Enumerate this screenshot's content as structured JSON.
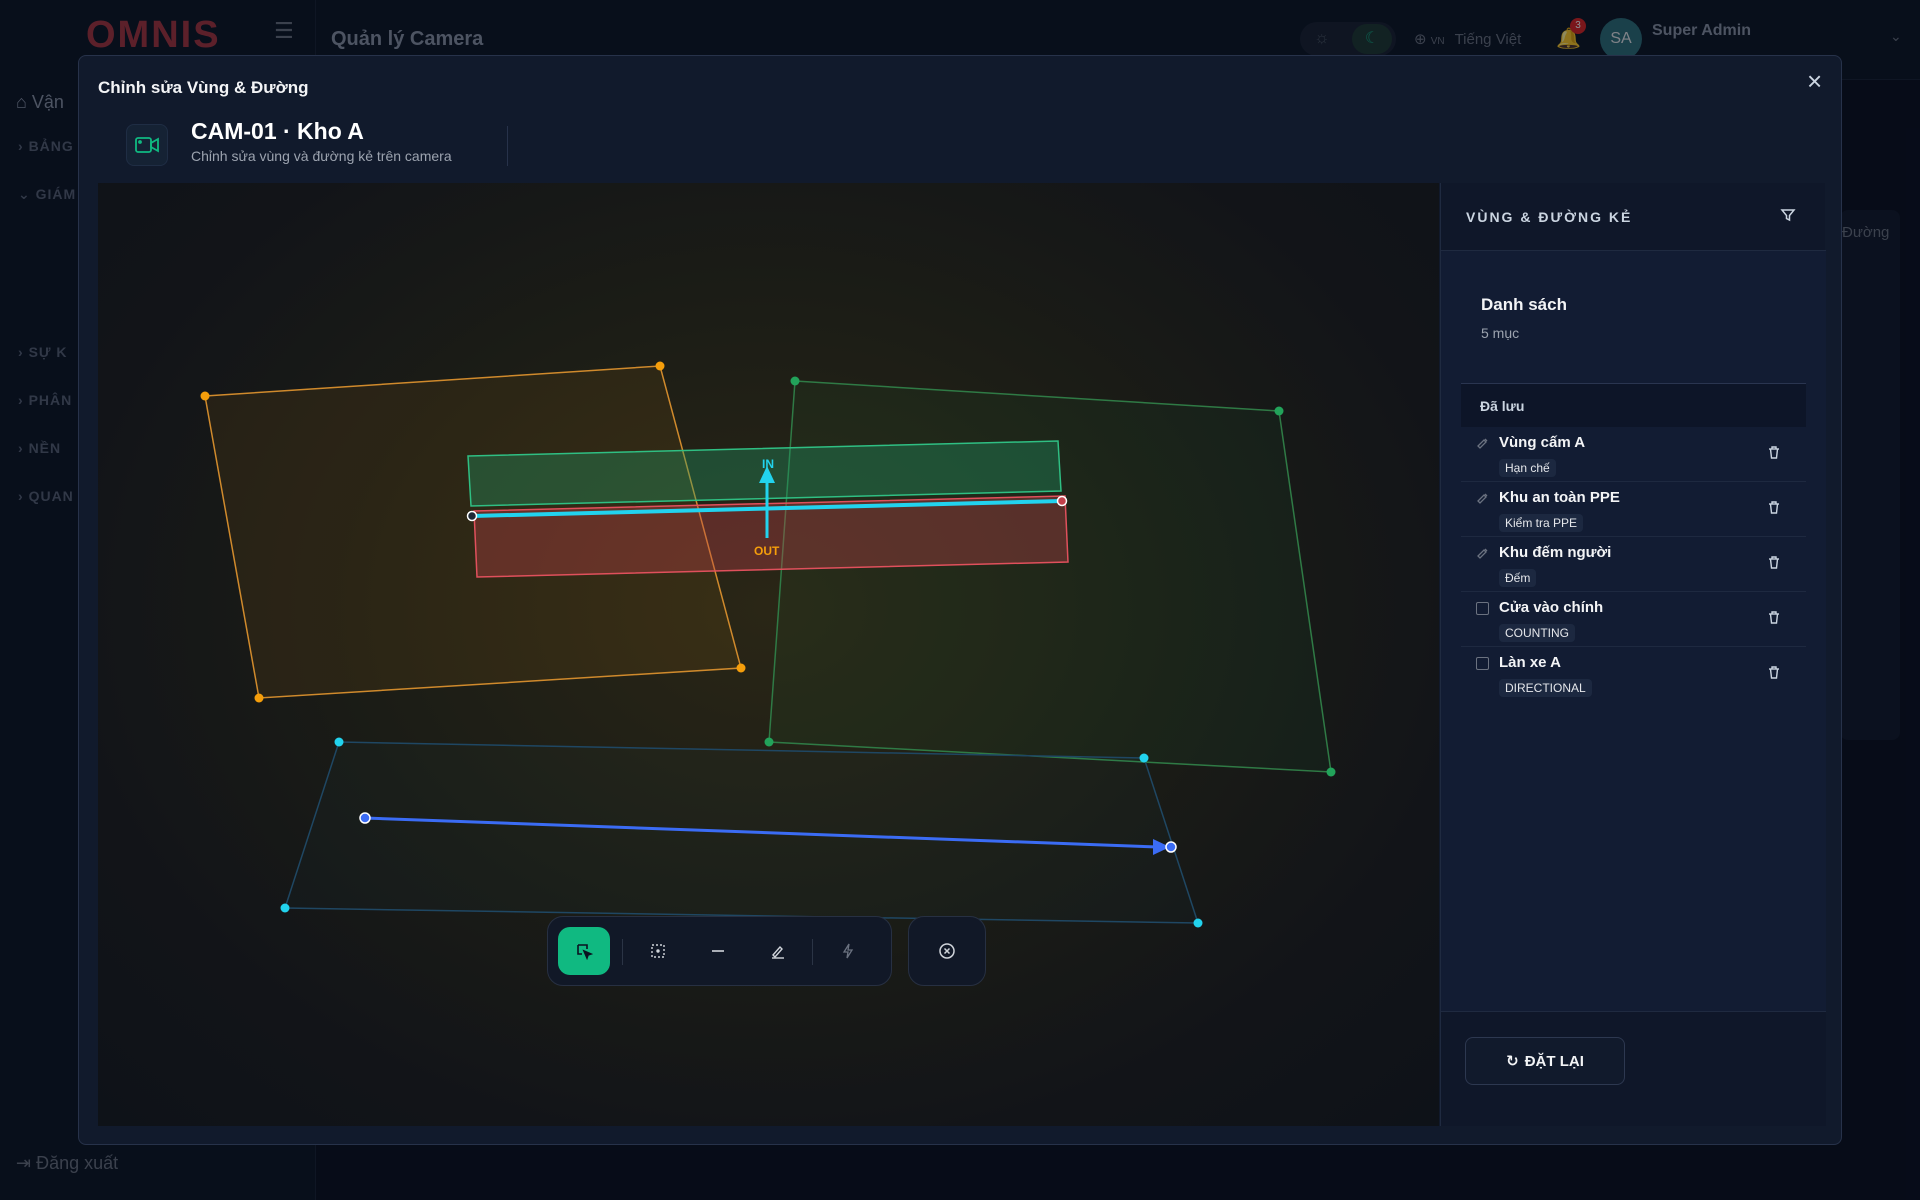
{
  "background": {
    "logo": "OMNIS",
    "page_title": "Quản lý Camera",
    "nav": {
      "home": "Vận",
      "sections": [
        "BẢNG",
        "GIÁM",
        "SỰ K",
        "PHÂN",
        "NỀN",
        "QUAN"
      ]
    },
    "logout": "Đăng xuất",
    "language": {
      "code": "VN",
      "label": "Tiếng Việt"
    },
    "notifications": "3",
    "user": {
      "initials": "SA",
      "name": "Super Admin"
    },
    "side_tab": "Đường"
  },
  "modal": {
    "title": "Chỉnh sửa Vùng & Đường",
    "camera": {
      "name": "CAM-01 · Kho A",
      "subtitle": "Chỉnh sửa vùng và đường kẻ trên camera"
    },
    "canvas": {
      "in_label": "IN",
      "out_label": "OUT"
    },
    "toolbar": {
      "tools": [
        "select-icon",
        "zone-icon",
        "line-icon",
        "draw-icon",
        "flash-icon"
      ],
      "active_tool": "select-icon",
      "cancel": "cancel-icon"
    },
    "panel": {
      "title": "VÙNG & ĐƯỜNG KẺ",
      "list_title": "Danh sách",
      "count": "5 mục",
      "saved_label": "Đã lưu",
      "items": [
        {
          "name": "Vùng cấm A",
          "tag": "Hạn chế",
          "saved": true
        },
        {
          "name": "Khu an toàn PPE",
          "tag": "Kiểm tra PPE",
          "saved": true
        },
        {
          "name": "Khu đếm người",
          "tag": "Đếm",
          "saved": true
        },
        {
          "name": "Cửa vào chính",
          "tag": "COUNTING",
          "saved": false
        },
        {
          "name": "Làn xe A",
          "tag": "DIRECTIONAL",
          "saved": false
        }
      ],
      "reset_label": "ĐẶT LẠI"
    }
  },
  "colors": {
    "accent": "#10b981",
    "zone_orange": "#f59e0b",
    "zone_green": "#22a35a",
    "zone_cyan": "#22d3ee",
    "line_cyan": "#22d3ee",
    "direction_blue": "#3b6cf5",
    "in_zone": "#1f9d6a",
    "out_zone": "#c2414b"
  }
}
